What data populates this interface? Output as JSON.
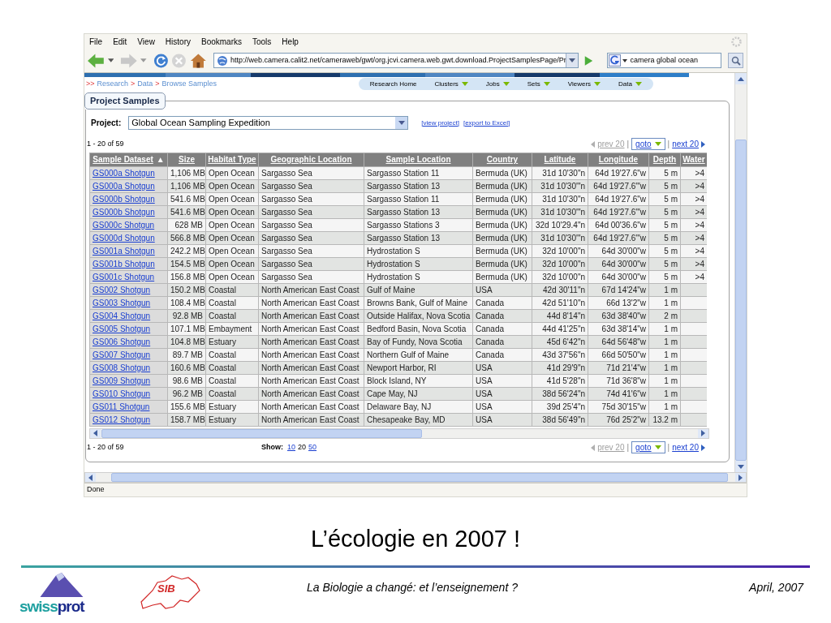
{
  "menu_bar": {
    "items": [
      "File",
      "Edit",
      "View",
      "History",
      "Bookmarks",
      "Tools",
      "Help"
    ]
  },
  "toolbar": {
    "url": "http://web.camera.calit2.net/cameraweb/gwt/org.jcvi.camera.web.gwt.download.ProjectSamplesPage/Pr",
    "search_value": "camera global ocean"
  },
  "breadcrumb": {
    "prefix": ">>",
    "separator": ">",
    "items": [
      "Research",
      "Data",
      "Browse Samples"
    ]
  },
  "sub_nav": [
    {
      "label": "Research Home",
      "dropdown": false
    },
    {
      "label": "Clusters",
      "dropdown": true
    },
    {
      "label": "Jobs",
      "dropdown": true
    },
    {
      "label": "Sets",
      "dropdown": true
    },
    {
      "label": "Viewers",
      "dropdown": true
    },
    {
      "label": "Data",
      "dropdown": true
    }
  ],
  "panel": {
    "title": "Project Samples",
    "project_label": "Project:",
    "project_value": "Global Ocean Sampling Expedition",
    "links": [
      "[view project]",
      "[export to Excel]"
    ],
    "range_top": "1 - 20 of 59",
    "range_bottom": "1 - 20 of 59",
    "pagers": [
      {
        "prev": {
          "label": "prev 20",
          "disabled": true
        },
        "separators": [
          "|",
          "|"
        ],
        "goto": "goto",
        "next": {
          "label": "next 20",
          "disabled": false
        }
      },
      {
        "prev": {
          "label": "prev 20",
          "disabled": true
        },
        "separators": [
          "|",
          "|"
        ],
        "goto": "goto",
        "next": {
          "label": "next 20",
          "disabled": false
        }
      }
    ],
    "show": {
      "label": "Show:",
      "options": [
        {
          "label": "10",
          "selected": false
        },
        {
          "label": "20",
          "selected": true
        },
        {
          "label": "50",
          "selected": false
        }
      ]
    }
  },
  "table": {
    "sort_indicator": "▲",
    "columns": [
      {
        "label": "Sample Dataset",
        "sorted": true
      },
      {
        "label": "Size",
        "sorted": false
      },
      {
        "label": "Habitat Type",
        "sorted": false
      },
      {
        "label": "Geographic Location",
        "sorted": false
      },
      {
        "label": "Sample Location",
        "sorted": false
      },
      {
        "label": "Country",
        "sorted": false
      },
      {
        "label": "Latitude",
        "sorted": false
      },
      {
        "label": "Longitude",
        "sorted": false
      },
      {
        "label": "Depth",
        "sorted": false
      },
      {
        "label": "Water",
        "sorted": false
      }
    ],
    "rows": [
      [
        "GS000a Shotgun",
        "1,106 MB",
        "Open Ocean",
        "Sargasso Sea",
        "Sargasso Station 11",
        "Bermuda (UK)",
        "31d 10'30\"n",
        "64d 19'27.6\"w",
        "5 m",
        ">4"
      ],
      [
        "GS000a Shotgun",
        "1,106 MB",
        "Open Ocean",
        "Sargasso Sea",
        "Sargasso Station 13",
        "Bermuda (UK)",
        "31d 10'30'\"n",
        "64d 19'27.6'\"w",
        "5 m",
        ">4"
      ],
      [
        "GS000b Shotgun",
        "541.6 MB",
        "Open Ocean",
        "Sargasso Sea",
        "Sargasso Station 11",
        "Bermuda (UK)",
        "31d 10'30\"n",
        "64d 19'27.6\"w",
        "5 m",
        ">4"
      ],
      [
        "GS000b Shotgun",
        "541.6 MB",
        "Open Ocean",
        "Sargasso Sea",
        "Sargasso Station 13",
        "Bermuda (UK)",
        "31d 10'30'\"n",
        "64d 19'27.6'\"w",
        "5 m",
        ">4"
      ],
      [
        "GS000c Shotgun",
        "628 MB",
        "Open Ocean",
        "Sargasso Sea",
        "Sargasso Stations 3",
        "Bermuda (UK)",
        "32d 10'29.4\"n",
        "64d 00'36.6\"w",
        "5 m",
        ">4"
      ],
      [
        "GS000d Shotgun",
        "566.8 MB",
        "Open Ocean",
        "Sargasso Sea",
        "Sargasso Station 13",
        "Bermuda (UK)",
        "31d 10'30'\"n",
        "64d 19'27.6'\"w",
        "5 m",
        ">4"
      ],
      [
        "GS001a Shotgun",
        "242.2 MB",
        "Open Ocean",
        "Sargasso Sea",
        "Hydrostation S",
        "Bermuda (UK)",
        "32d 10'00\"n",
        "64d 30'00\"w",
        "5 m",
        ">4"
      ],
      [
        "GS001b Shotgun",
        "154.5 MB",
        "Open Ocean",
        "Sargasso Sea",
        "Hydrostation S",
        "Bermuda (UK)",
        "32d 10'00\"n",
        "64d 30'00\"w",
        "5 m",
        ">4"
      ],
      [
        "GS001c Shotgun",
        "156.8 MB",
        "Open Ocean",
        "Sargasso Sea",
        "Hydrostation S",
        "Bermuda (UK)",
        "32d 10'00\"n",
        "64d 30'00\"w",
        "5 m",
        ">4"
      ],
      [
        "GS002 Shotgun",
        "150.2 MB",
        "Coastal",
        "North American East Coast",
        "Gulf of Maine",
        "USA",
        "42d 30'11\"n",
        "67d 14'24\"w",
        "1 m"
      ],
      [
        "GS003 Shotgun",
        "108.4 MB",
        "Coastal",
        "North American East Coast",
        "Browns Bank, Gulf of Maine",
        "Canada",
        "42d 51'10\"n",
        "66d 13'2\"w",
        "1 m"
      ],
      [
        "GS004 Shotgun",
        "92.8 MB",
        "Coastal",
        "North American East Coast",
        "Outside Halifax, Nova Scotia",
        "Canada",
        "44d 8'14\"n",
        "63d 38'40\"w",
        "2 m"
      ],
      [
        "GS005 Shotgun",
        "107.1 MB",
        "Embayment",
        "North American East Coast",
        "Bedford Basin, Nova Scotia",
        "Canada",
        "44d 41'25\"n",
        "63d 38'14\"w",
        "1 m"
      ],
      [
        "GS006 Shotgun",
        "104.8 MB",
        "Estuary",
        "North American East Coast",
        "Bay of Fundy, Nova Scotia",
        "Canada",
        "45d 6'42\"n",
        "64d 56'48\"w",
        "1 m"
      ],
      [
        "GS007 Shotgun",
        "89.7 MB",
        "Coastal",
        "North American East Coast",
        "Northern Gulf of Maine",
        "Canada",
        "43d 37'56\"n",
        "66d 50'50\"w",
        "1 m"
      ],
      [
        "GS008 Shotgun",
        "160.6 MB",
        "Coastal",
        "North American East Coast",
        "Newport Harbor, RI",
        "USA",
        "41d 29'9\"n",
        "71d 21'4\"w",
        "1 m"
      ],
      [
        "GS009 Shotgun",
        "98.6 MB",
        "Coastal",
        "North American East Coast",
        "Block Island, NY",
        "USA",
        "41d 5'28\"n",
        "71d 36'8\"w",
        "1 m"
      ],
      [
        "GS010 Shotgun",
        "96.2 MB",
        "Coastal",
        "North American East Coast",
        "Cape May, NJ",
        "USA",
        "38d 56'24\"n",
        "74d 41'6\"w",
        "1 m"
      ],
      [
        "GS011 Shotgun",
        "155.6 MB",
        "Estuary",
        "North American East Coast",
        "Delaware Bay, NJ",
        "USA",
        "39d 25'4\"n",
        "75d 30'15\"w",
        "1 m"
      ],
      [
        "GS012 Shotgun",
        "158.7 MB",
        "Estuary",
        "North American East Coast",
        "Chesapeake Bay, MD",
        "USA",
        "38d 56'49\"n",
        "76d 25'2\"w",
        "13.2 m"
      ]
    ]
  },
  "status_bar": {
    "text": "Done"
  },
  "slide": {
    "title": "L’écologie en 2007 !",
    "footer_center": "La Biologie a changé: et l’enseignement ?",
    "footer_right": "April, 2007",
    "logo_left": [
      "swiss",
      "prot"
    ],
    "logo_right": "SIB"
  }
}
